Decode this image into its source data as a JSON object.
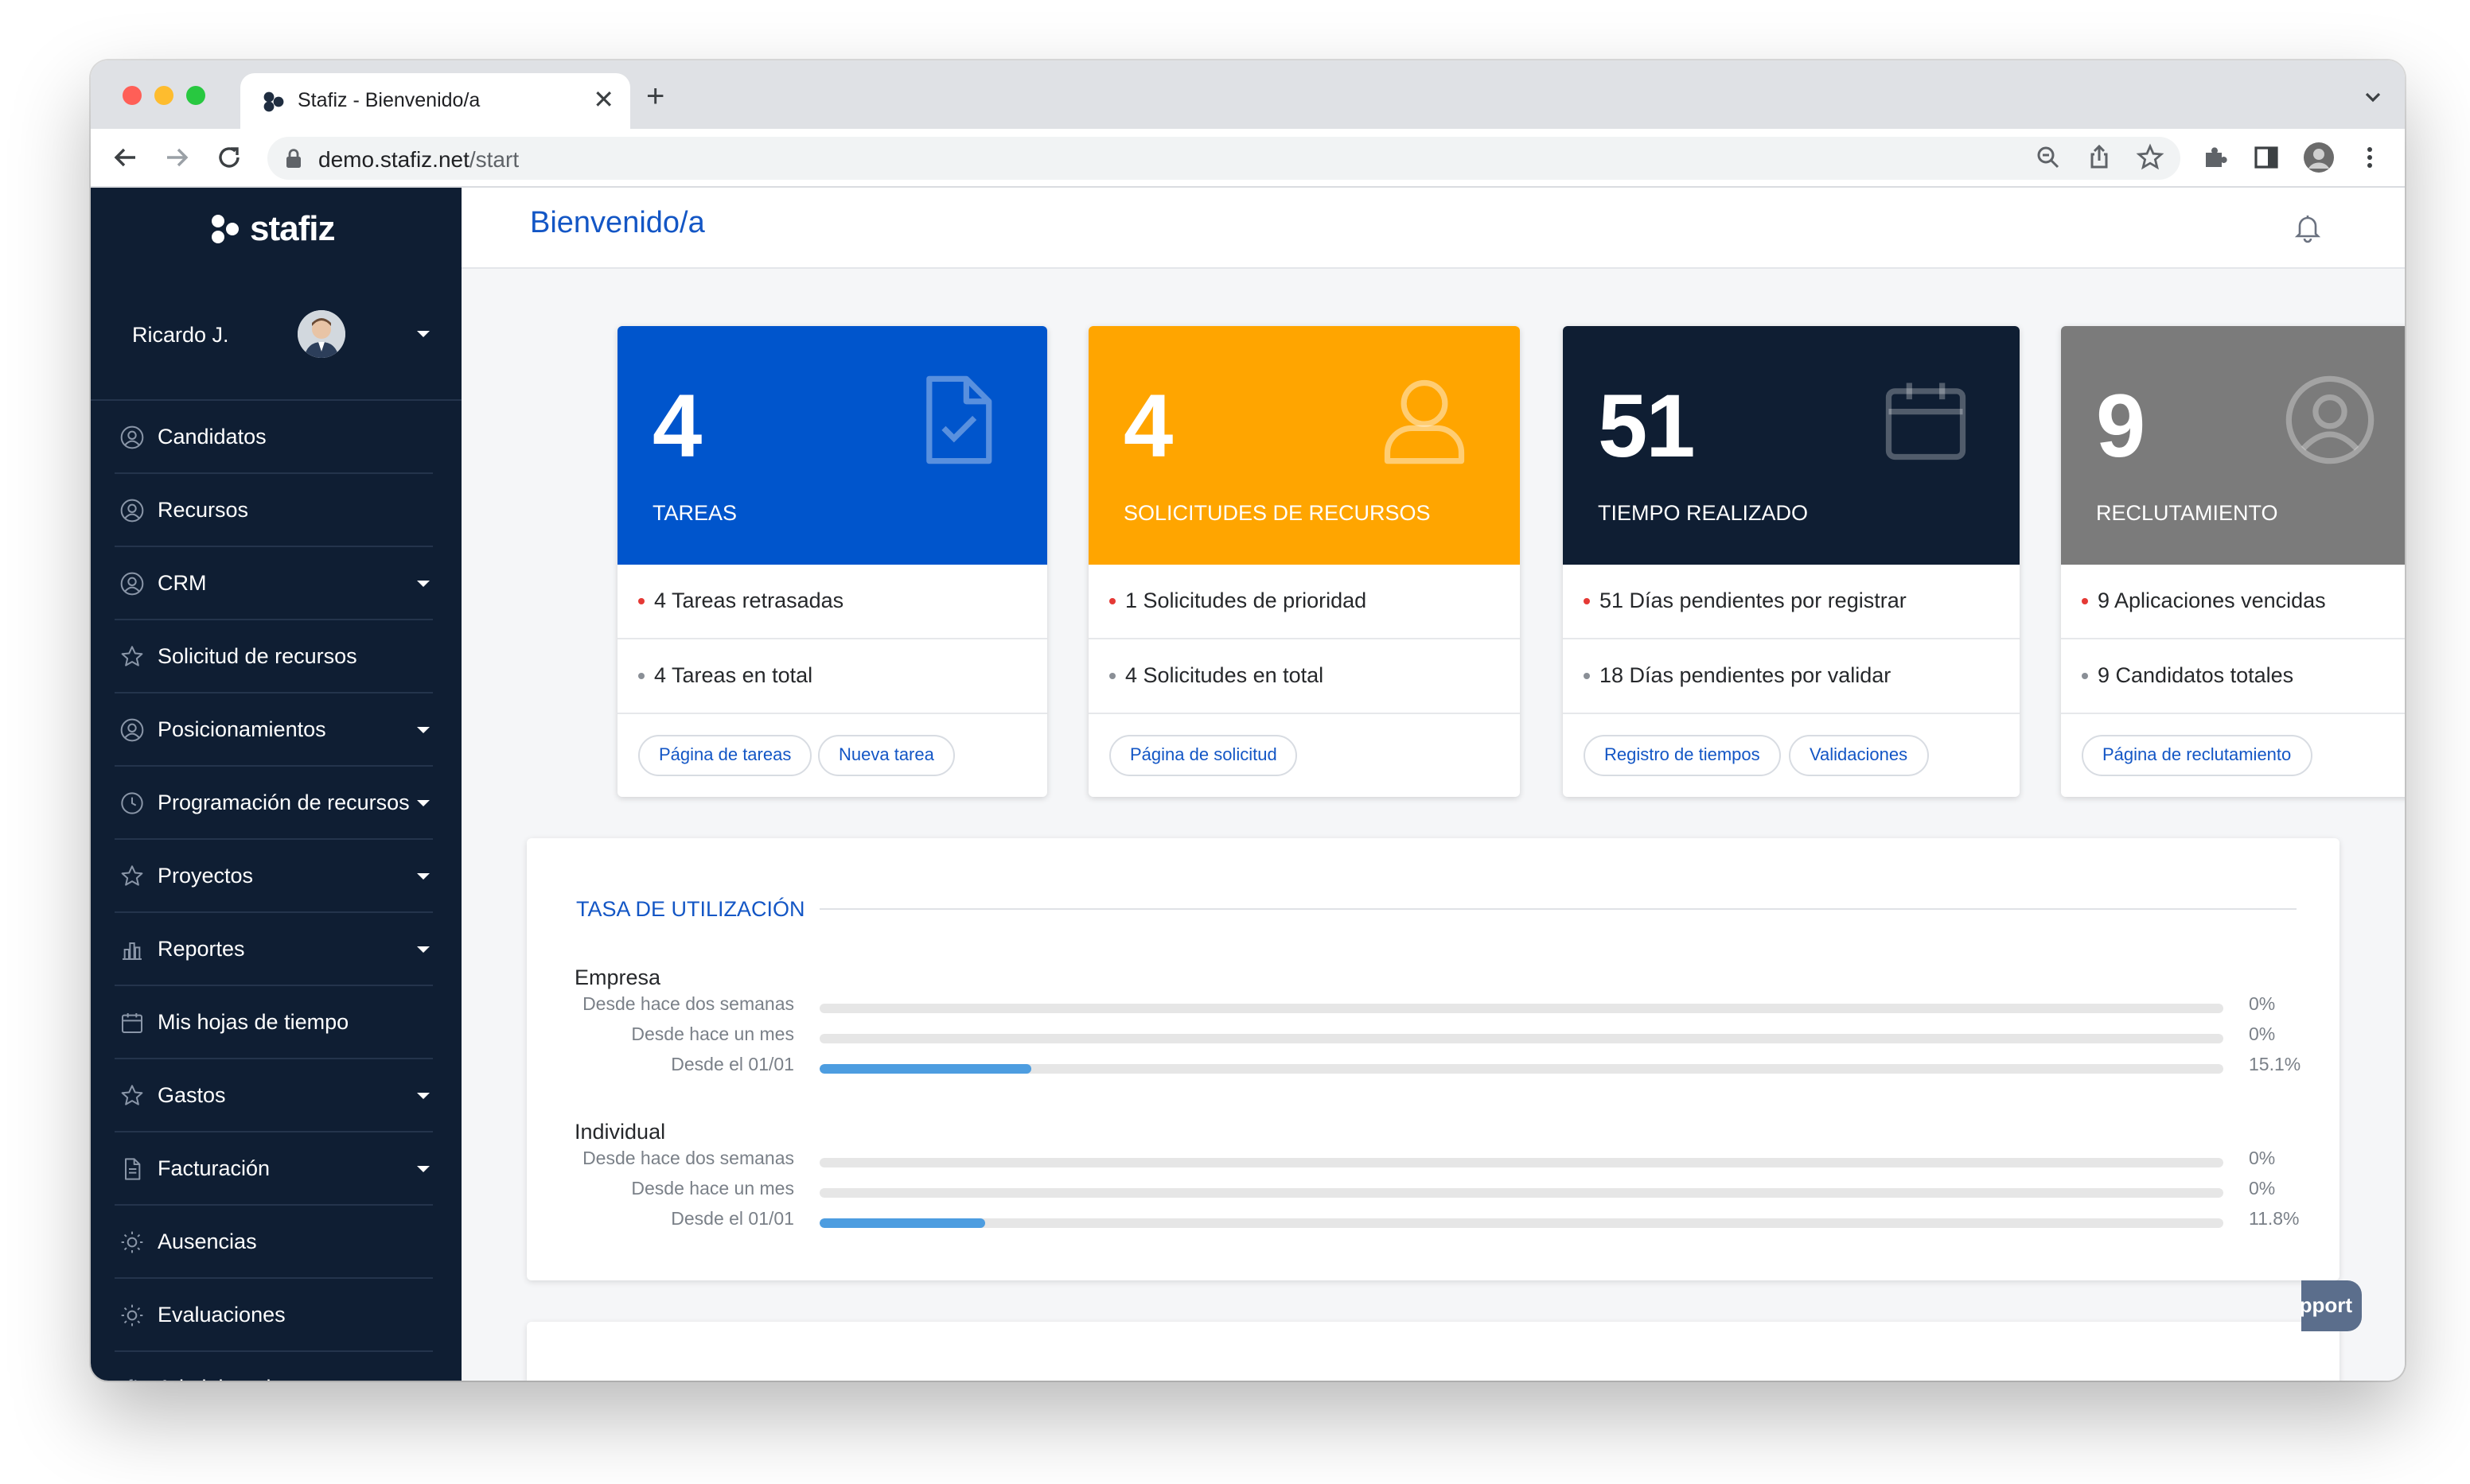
{
  "browser": {
    "tab_title": "Stafiz - Bienvenido/a",
    "tab_close": "✕",
    "new_tab": "+",
    "url_host": "demo.stafiz.net",
    "url_path": "/start"
  },
  "brand": {
    "logo_text": "stafiz",
    "accent": "#1356c5",
    "sidebar_bg": "#0f1e33"
  },
  "user": {
    "name": "Ricardo J."
  },
  "sidebar": {
    "items": [
      {
        "label": "Candidatos",
        "icon": "user-circle-icon",
        "caret": false
      },
      {
        "label": "Recursos",
        "icon": "user-circle-icon",
        "caret": false
      },
      {
        "label": "CRM",
        "icon": "user-circle-icon",
        "caret": true
      },
      {
        "label": "Solicitud de recursos",
        "icon": "star-icon",
        "caret": false
      },
      {
        "label": "Posicionamientos",
        "icon": "user-circle-icon",
        "caret": true
      },
      {
        "label": "Programación de recursos",
        "icon": "clock-icon",
        "caret": true
      },
      {
        "label": "Proyectos",
        "icon": "star-icon",
        "caret": true
      },
      {
        "label": "Reportes",
        "icon": "chart-icon",
        "caret": true
      },
      {
        "label": "Mis hojas de tiempo",
        "icon": "calendar-icon",
        "caret": false
      },
      {
        "label": "Gastos",
        "icon": "star-icon",
        "caret": true
      },
      {
        "label": "Facturación",
        "icon": "document-icon",
        "caret": true
      },
      {
        "label": "Ausencias",
        "icon": "sun-icon",
        "caret": false
      },
      {
        "label": "Evaluaciones",
        "icon": "sun-icon",
        "caret": false
      },
      {
        "label": "Administrador",
        "icon": "gear-icon",
        "caret": false
      }
    ]
  },
  "header": {
    "title": "Bienvenido/a"
  },
  "cards": [
    {
      "number": "4",
      "caption": "TAREAS",
      "color": "#0055cc",
      "icon": "document-check-icon",
      "rows": [
        {
          "text": "4 Tareas retrasadas",
          "bullet": "#e53935"
        },
        {
          "text": "4 Tareas en total",
          "bullet": "#8a8f96"
        }
      ],
      "buttons": [
        "Página de tareas",
        "Nueva tarea"
      ]
    },
    {
      "number": "4",
      "caption": "SOLICITUDES DE RECURSOS",
      "color": "#ffa500",
      "icon": "person-icon",
      "rows": [
        {
          "text": "1 Solicitudes de prioridad",
          "bullet": "#e53935"
        },
        {
          "text": "4 Solicitudes en total",
          "bullet": "#8a8f96"
        }
      ],
      "buttons": [
        "Página de solicitud"
      ]
    },
    {
      "number": "51",
      "caption": "TIEMPO REALIZADO",
      "color": "#0f1e33",
      "icon": "calendar-icon",
      "rows": [
        {
          "text": "51 Días pendientes por registrar",
          "bullet": "#e53935"
        },
        {
          "text": "18 Días pendientes por validar",
          "bullet": "#8a8f96"
        }
      ],
      "buttons": [
        "Registro de tiempos",
        "Validaciones"
      ]
    },
    {
      "number": "9",
      "caption": "RECLUTAMIENTO",
      "color": "#7b7b7b",
      "icon": "user-circle-icon",
      "rows": [
        {
          "text": "9 Aplicaciones vencidas",
          "bullet": "#e53935"
        },
        {
          "text": "9 Candidatos totales",
          "bullet": "#8a8f96"
        }
      ],
      "buttons": [
        "Página de reclutamiento"
      ]
    }
  ],
  "utilization": {
    "title": "TASA DE UTILIZACIÓN",
    "groups": [
      {
        "label": "Empresa",
        "bars": [
          {
            "label": "Desde hace dos semanas",
            "value": "0%",
            "percent": 0
          },
          {
            "label": "Desde hace un mes",
            "value": "0%",
            "percent": 0
          },
          {
            "label": "Desde el 01/01",
            "value": "15.1%",
            "percent": 15.1
          }
        ]
      },
      {
        "label": "Individual",
        "bars": [
          {
            "label": "Desde hace dos semanas",
            "value": "0%",
            "percent": 0
          },
          {
            "label": "Desde hace un mes",
            "value": "0%",
            "percent": 0
          },
          {
            "label": "Desde el 01/01",
            "value": "11.8%",
            "percent": 11.8
          }
        ]
      }
    ]
  },
  "support": {
    "label": "Support"
  }
}
